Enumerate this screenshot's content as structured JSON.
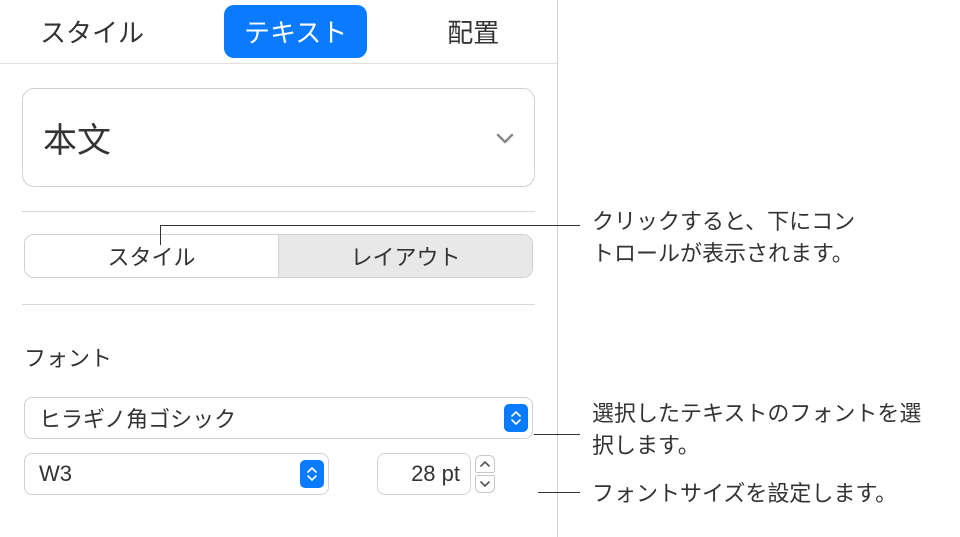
{
  "tabs": {
    "style": "スタイル",
    "text": "テキスト",
    "arrange": "配置"
  },
  "paragraph_style": {
    "current": "本文"
  },
  "segmented": {
    "style": "スタイル",
    "layout": "レイアウト"
  },
  "font_section": {
    "label": "フォント",
    "family": "ヒラギノ角ゴシック",
    "weight": "W3",
    "size": "28 pt"
  },
  "callouts": {
    "segment": "クリックすると、下にコントロールが表示されます。",
    "font": "選択したテキストのフォントを選択します。",
    "size": "フォントサイズを設定します。"
  }
}
